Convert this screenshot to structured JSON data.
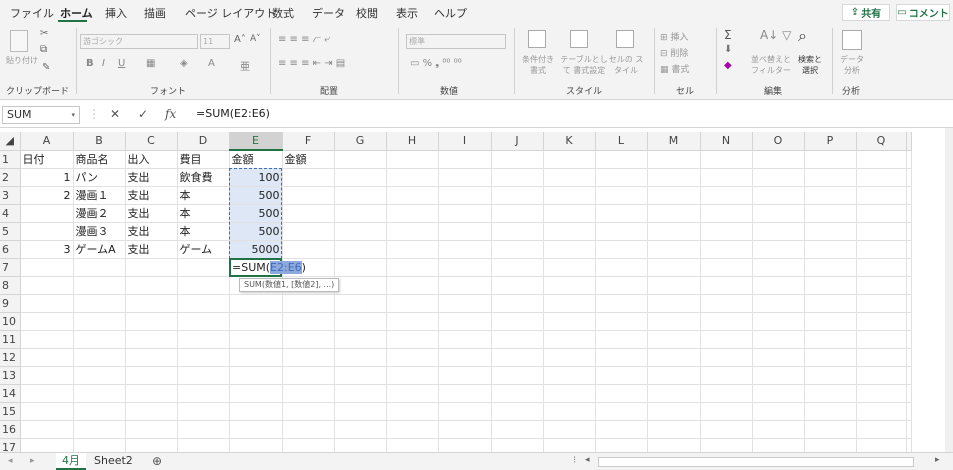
{
  "menu": [
    "ファイル",
    "ホーム",
    "挿入",
    "描画",
    "ページ レイアウト",
    "数式",
    "データ",
    "校閲",
    "表示",
    "ヘルプ"
  ],
  "share_label": "共有",
  "comment_label": "コメント",
  "ribbon": {
    "groups": [
      "クリップボード",
      "フォント",
      "配置",
      "数値",
      "スタイル",
      "セル",
      "編集",
      "分析"
    ],
    "paste": "貼り付け",
    "font_name": "游ゴシック",
    "font_size": "11",
    "number_format": "標準",
    "cond_format": "条件付き 書式",
    "table_format": "テーブルとして 書式設定",
    "cell_style": "セルの スタイル",
    "insert": "挿入",
    "delete": "削除",
    "format": "書式",
    "sort_filter": "並べ替えと フィルター",
    "find_select": "検索と 選択",
    "data_analysis": "データ 分析"
  },
  "namebox": "SUM",
  "formula": "=SUM(E2:E6)",
  "columns": [
    "A",
    "B",
    "C",
    "D",
    "E",
    "F",
    "G",
    "H",
    "I",
    "J",
    "K",
    "L",
    "M",
    "N",
    "O",
    "P",
    "Q"
  ],
  "rows": [
    [
      "日付",
      "商品名",
      "出入",
      "費目",
      "金額",
      "金額"
    ],
    [
      "1",
      "パン",
      "支出",
      "飲食費",
      "100",
      ""
    ],
    [
      "2",
      "漫画１",
      "支出",
      "本",
      "500",
      ""
    ],
    [
      "",
      "漫画２",
      "支出",
      "本",
      "500",
      ""
    ],
    [
      "",
      "漫画３",
      "支出",
      "本",
      "500",
      ""
    ],
    [
      "3",
      "ゲームA",
      "支出",
      "ゲーム",
      "5000",
      ""
    ],
    [
      "",
      "",
      "",
      "",
      "=SUM(E2:E6)",
      ""
    ]
  ],
  "row_numbers": [
    "1",
    "2",
    "3",
    "4",
    "5",
    "6",
    "7",
    "8",
    "9",
    "10",
    "11",
    "12",
    "13",
    "14",
    "15",
    "16",
    "17"
  ],
  "tooltip": "SUM(数値1, [数値2], ...)",
  "sheets": [
    "4月",
    "Sheet2"
  ],
  "accent_color": "#217346"
}
